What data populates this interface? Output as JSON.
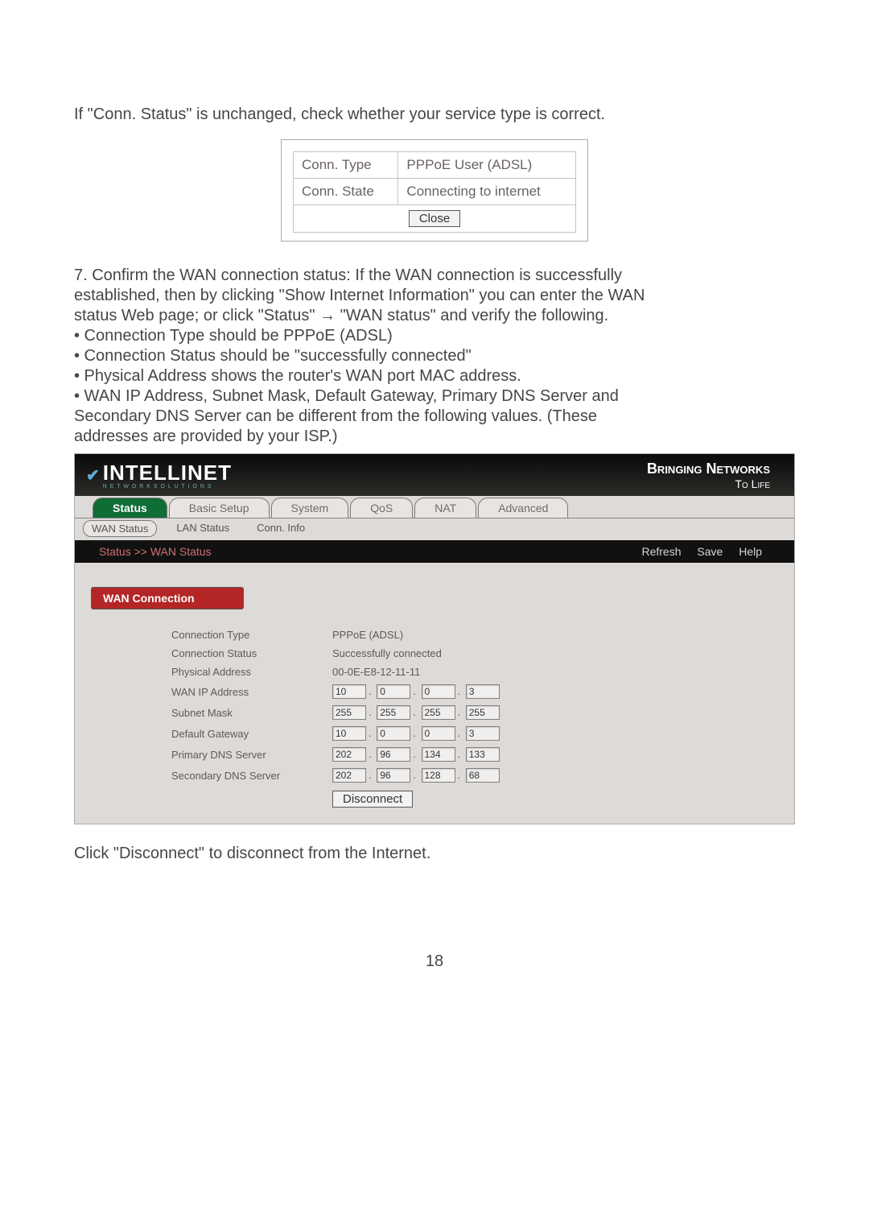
{
  "intro": "If \"Conn. Status\" is unchanged, check whether your service type is correct.",
  "smallTable": {
    "r1": {
      "label": "Conn. Type",
      "value": "PPPoE User (ADSL)"
    },
    "r2": {
      "label": "Conn. State",
      "value": "Connecting to internet"
    },
    "closeLabel": "Close"
  },
  "para2": {
    "l1": "7. Confirm the WAN connection status: If the WAN connection is successfully",
    "l2": "established, then by clicking \"Show Internet Information\" you can enter the WAN",
    "l3": "status Web page; or click \"Status\" → \"WAN status\" and verify the following.",
    "b1": "• Connection Type should be PPPoE (ADSL)",
    "b2": "• Connection Status should be \"successfully connected\"",
    "b3": "• Physical Address shows the router's WAN port MAC address.",
    "b4": "• WAN IP Address, Subnet Mask, Default Gateway, Primary DNS Server and",
    "b5": "Secondary DNS Server can be different from the following values. (These",
    "b6": "addresses are provided by your ISP.)"
  },
  "screenshot": {
    "brandName": "INTELLINET",
    "brandSub": "N E T W O R K   S O L U T I O N S",
    "slogan1": "Bringing Networks",
    "slogan2": "To Life",
    "tabs": [
      "Status",
      "Basic Setup",
      "System",
      "QoS",
      "NAT",
      "Advanced"
    ],
    "subtabs": [
      "WAN Status",
      "LAN Status",
      "Conn. Info"
    ],
    "crumb": "Status >> WAN Status",
    "actions": [
      "Refresh",
      "Save",
      "Help"
    ],
    "sectionTitle": "WAN Connection",
    "rows": {
      "connType": {
        "label": "Connection Type",
        "value": "PPPoE (ADSL)"
      },
      "connStatus": {
        "label": "Connection Status",
        "value": "Successfully connected"
      },
      "physAddr": {
        "label": "Physical Address",
        "value": "00-0E-E8-12-11-11"
      },
      "wanIp": {
        "label": "WAN IP Address",
        "oct": [
          "10",
          "0",
          "0",
          "3"
        ]
      },
      "subnet": {
        "label": "Subnet Mask",
        "oct": [
          "255",
          "255",
          "255",
          "255"
        ]
      },
      "gateway": {
        "label": "Default Gateway",
        "oct": [
          "10",
          "0",
          "0",
          "3"
        ]
      },
      "dns1": {
        "label": "Primary DNS Server",
        "oct": [
          "202",
          "96",
          "134",
          "133"
        ]
      },
      "dns2": {
        "label": "Secondary DNS Server",
        "oct": [
          "202",
          "96",
          "128",
          "68"
        ]
      }
    },
    "disconnectLabel": "Disconnect"
  },
  "outro": "Click \"Disconnect\" to disconnect from the Internet.",
  "pageNum": "18"
}
